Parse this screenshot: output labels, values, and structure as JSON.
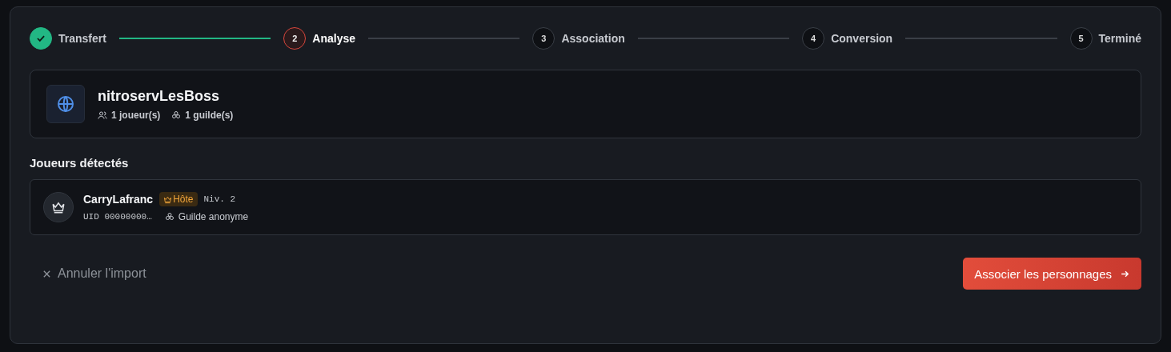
{
  "steps": [
    {
      "label": "Transfert",
      "kind": "done"
    },
    {
      "number": "2",
      "label": "Analyse",
      "kind": "current"
    },
    {
      "number": "3",
      "label": "Association",
      "kind": "pending"
    },
    {
      "number": "4",
      "label": "Conversion",
      "kind": "pending"
    },
    {
      "number": "5",
      "label": "Terminé",
      "kind": "pending"
    }
  ],
  "server": {
    "name": "nitroservLesBoss",
    "players": "1 joueur(s)",
    "guilds": "1 guilde(s)"
  },
  "players_heading": "Joueurs détectés",
  "players": [
    {
      "name": "CarryLafranc",
      "badge": "Hôte",
      "host": true,
      "level": "Niv. 2",
      "uid": "UID 00000000…",
      "guild": "Guilde anonyme"
    }
  ],
  "cancel": "Annuler l'import",
  "submit": "Associer les personnages"
}
